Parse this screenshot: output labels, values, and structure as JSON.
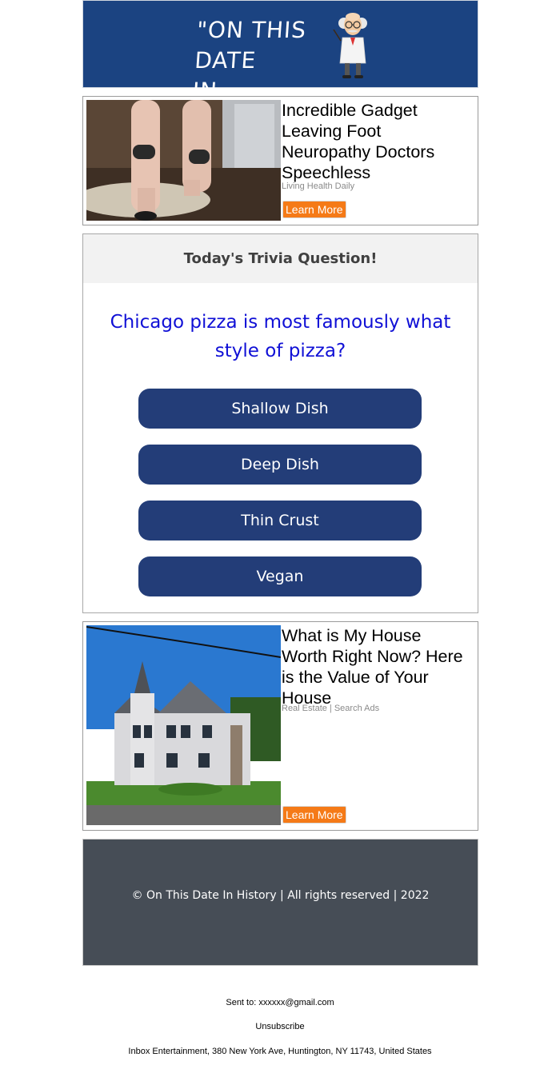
{
  "header": {
    "logo_text": "\"ON THIS DATE\nIN HISTORY...\"",
    "brand_color": "#1b4381"
  },
  "ads": [
    {
      "title": "Incredible Gadget Leaving Foot Neuropathy Doctors Speechless",
      "source": "Living Health Daily",
      "cta": "Learn More"
    },
    {
      "title": "What is My House Worth Right Now? Here is the Value of Your House",
      "source": "Real Estate | Search Ads",
      "cta": "Learn More"
    }
  ],
  "trivia": {
    "heading": "Today's Trivia Question!",
    "question": "Chicago pizza is most famously what style of pizza?",
    "answers": [
      "Shallow Dish",
      "Deep Dish",
      "Thin Crust",
      "Vegan"
    ],
    "question_color": "#1010d6",
    "button_color": "#233d78"
  },
  "footer": {
    "copyright": "© On This Date In History | All rights reserved | 2022",
    "background_color": "#464d56"
  },
  "meta": {
    "sent_to": "Sent to: xxxxxx@gmail.com",
    "unsubscribe": "Unsubscribe",
    "address": "Inbox Entertainment, 380 New York Ave, Huntington, NY 11743, United States"
  },
  "accent_color": "#f57a17"
}
